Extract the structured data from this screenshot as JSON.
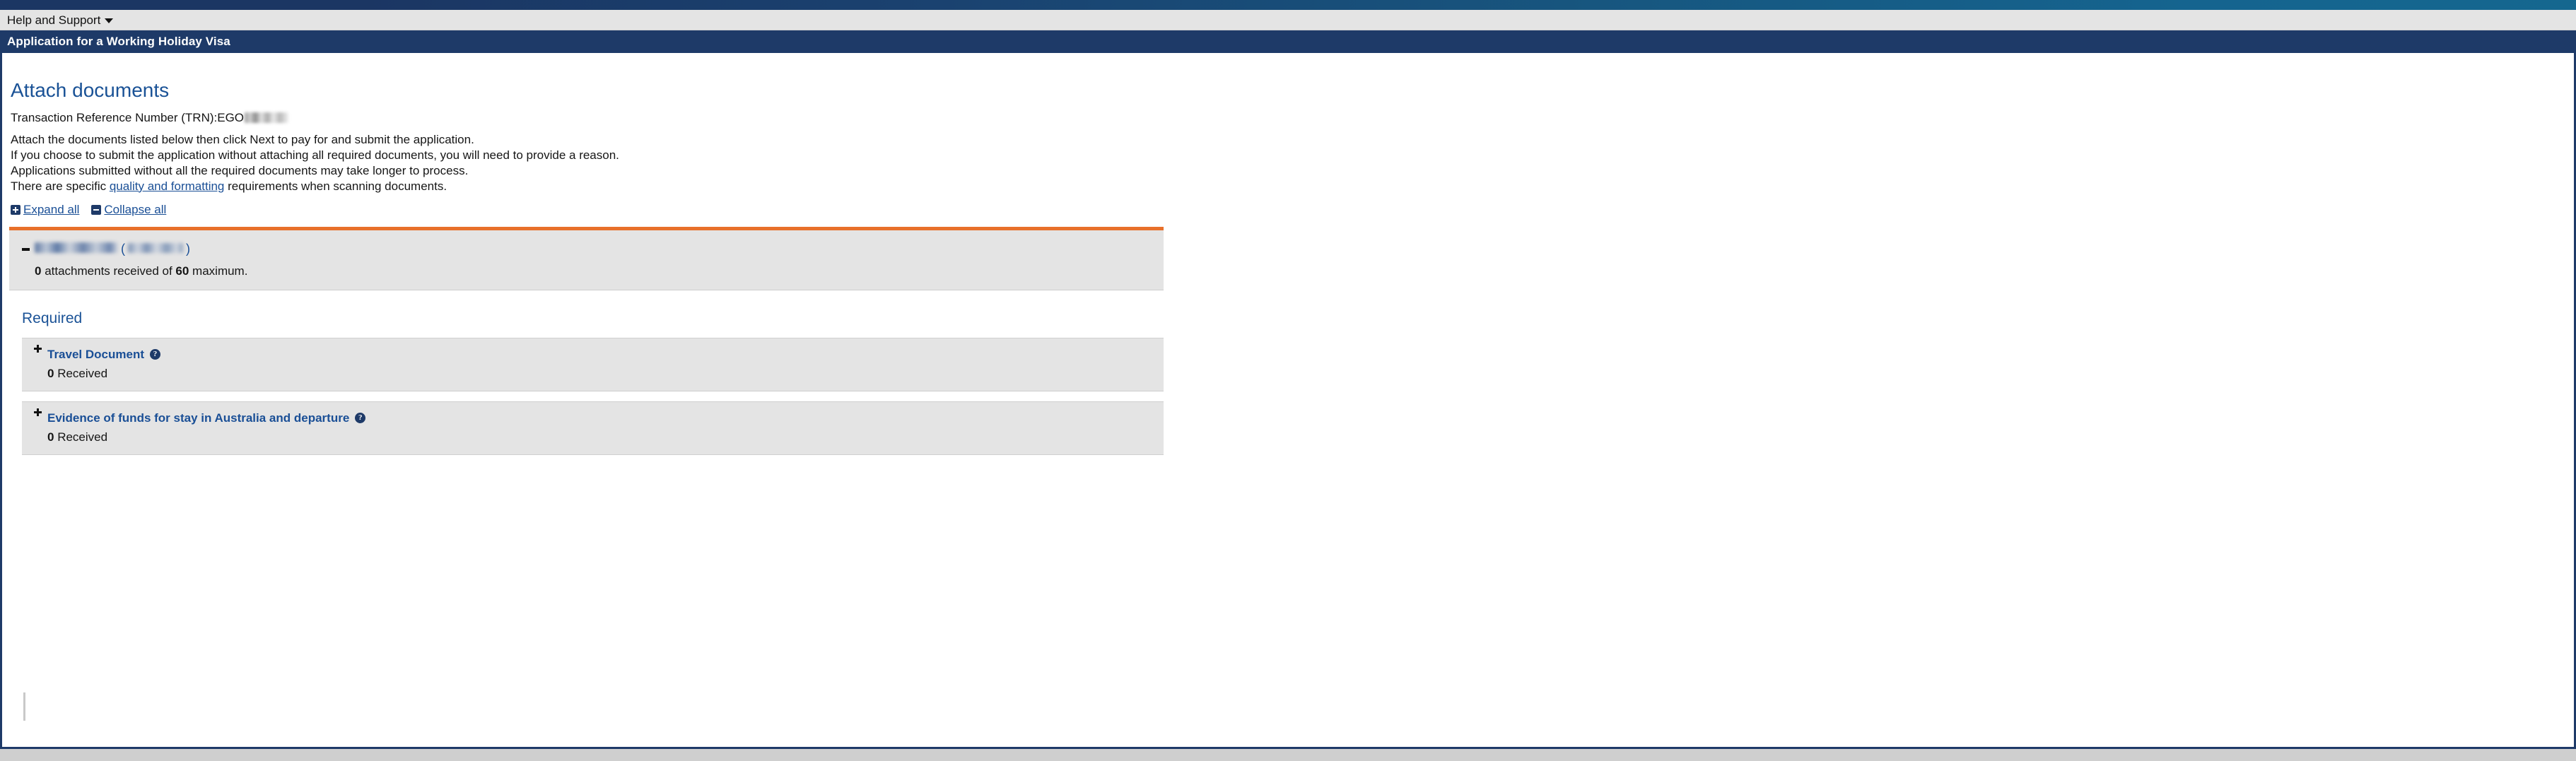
{
  "brand": {
    "accent_navy": "#1e3a68",
    "accent_blue": "#1a4f96",
    "accent_orange": "#e8702a",
    "panel_gray": "#e4e4e4"
  },
  "utility_bar": {
    "help_menu_label": "Help and Support",
    "caret_icon": "chevron-down-icon"
  },
  "application": {
    "title": "Application for a Working Holiday Visa"
  },
  "main": {
    "page_heading": "Attach documents",
    "trn_label": "Transaction Reference Number (TRN):EGO",
    "trn_redacted": true,
    "instructions": [
      "Attach the documents listed below then click Next to pay for and submit the application.",
      "If you choose to submit the application without attaching all required documents, you will need to provide a reason.",
      "Applications submitted without all the required documents may take longer to process."
    ],
    "quality_line": {
      "before": "There are specific ",
      "link_text": "quality and formatting",
      "after": " requirements when scanning documents."
    },
    "expand_all_label": "Expand all",
    "collapse_all_label": "Collapse all"
  },
  "applicant": {
    "name_redacted": true,
    "dob_redacted": true,
    "open_paren": "(",
    "close_paren": ")",
    "attachments_received": "0",
    "attachments_mid_text": " attachments received of ",
    "attachments_max": "60",
    "attachments_suffix": " maximum.",
    "toggle_state": "expanded",
    "toggle_icon": "minus-icon"
  },
  "required": {
    "section_heading": "Required",
    "documents": [
      {
        "title": "Travel Document",
        "help_icon": "question-mark-icon",
        "help_glyph": "?",
        "received_count": "0",
        "received_label": " Received",
        "toggle_icon": "plus-icon"
      },
      {
        "title": "Evidence of funds for stay in Australia and departure",
        "help_icon": "question-mark-icon",
        "help_glyph": "?",
        "received_count": "0",
        "received_label": " Received",
        "toggle_icon": "plus-icon"
      }
    ]
  }
}
